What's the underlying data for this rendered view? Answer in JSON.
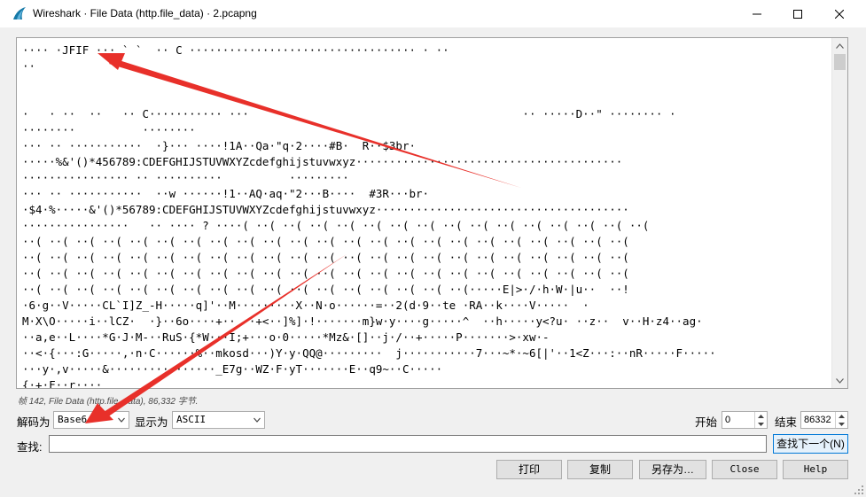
{
  "titlebar": {
    "title": "Wireshark · File Data (http.file_data) · 2.pcapng",
    "app_icon": "wireshark-fin-icon",
    "minimize_icon": "minimize-icon",
    "maximize_icon": "maximize-icon",
    "close_icon": "close-icon"
  },
  "content": {
    "lines": [
      "···· ·JFIF ··· ` `  ·· C ·································· · ··",
      "··",
      "",
      "",
      "·   · ··  ··   ·· C··········· ···                                         ·· ·····D··\" ········ ·",
      "········          ········",
      "··· ·· ···········  ·}··· ····!1A··Qa·\"q·2····#B·  R··$3br·",
      "·····%&'()*456789:CDEFGHIJSTUVWXYZcdefghijstuvwxyz········································",
      "················ ·· ··········          ·········",
      "··· ·· ···········  ··w ······!1··AQ·aq·\"2···B····  #3R···br·",
      "·$4·%·····&'()*56789:CDEFGHIJSTUVWXYZcdefghijstuvwxyz······································",
      "················   ·· ···· ? ····( ··( ··( ··( ··( ··( ··( ··( ··( ··( ··( ··( ··( ··( ··( ··(",
      "··( ··( ··( ··( ··( ··( ··( ··( ··( ··( ··( ··( ··( ··( ··( ··( ··( ··( ··( ··( ··( ··( ··(",
      "··( ··( ··( ··( ··( ··( ··( ··( ··( ··( ··( ··( ··( ··( ··( ··( ··( ··( ··( ··( ··( ··( ··(",
      "··( ··( ··( ··( ··( ··( ··( ··( ··( ··( ··( ··( ··( ··( ··( ··( ··( ··( ··( ··( ··( ··( ··(",
      "··( ··( ··( ··( ··( ··( ··( ··( ··( ··( ··( ··( ··( ··( ··( ··( ··(·····E|>·/·h·W·|u··  ··!",
      "·6·g··V·····CL`I]Z_-H·····q]'··M·········X··N·o······=··2(d·9··te ·RA··k····V·····  ·",
      "M·X\\O·····i··lCZ·  ·}··6o····+··  ·+<··]%]·!·······m}w·y····g·····^  ··h·····y<?u· ··z··  v··H·z4··ag·",
      "··a,e··L····*G·J·M-··RuS·{*W···I;+···o·0·····*Mz&·[]··j·/··+·····P·······>·xw·-",
      "··<·{···:G·····,·n·C······%··mkosd···)Y·y·QQ@·········  j···········7···~*·~6[|'··1<Z···:··nR·····F·····",
      "···y·,v·····&················_E7g··WZ·F·yT·······E··q9~··C·····",
      "{·+·F··r····"
    ],
    "status": "帧 142, File Data (http.file_data), 86,332 字节."
  },
  "controls": {
    "decode_label": "解码为",
    "decode_value": "Base64",
    "display_label": "显示为",
    "display_value": "ASCII",
    "start_label": "开始",
    "start_value": "0",
    "end_label": "结束",
    "end_value": "86332"
  },
  "search": {
    "label": "查找:",
    "value": "",
    "find_next_label": "查找下一个(N)"
  },
  "buttons": {
    "print": "打印",
    "copy": "复制",
    "save_as": "另存为…",
    "close": "Close",
    "help": "Help"
  },
  "colors": {
    "annotation_arrow": "#e8302a",
    "find_next_border": "#0078d7"
  }
}
